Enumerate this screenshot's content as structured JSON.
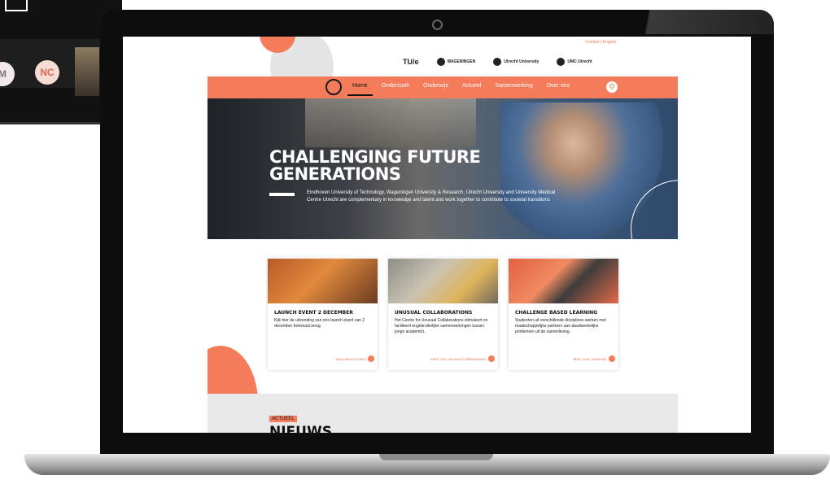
{
  "background_call": {
    "avatar_m": "M",
    "avatar_nc": "NC"
  },
  "site": {
    "top_links": "Contact | English",
    "logos": {
      "tue": "TU/e",
      "wageningen": "WAGENINGEN",
      "utrecht": "Utrecht University",
      "umc": "UMC Utrecht"
    },
    "nav": [
      "Home",
      "Onderzoek",
      "Onderwijs",
      "Actueel",
      "Samenwerking",
      "Over ons"
    ],
    "hero": {
      "title_line1": "CHALLENGING FUTURE",
      "title_line2": "GENERATIONS",
      "text": "Eindhoven University of Technology, Wageningen University & Research, Utrecht University and University Medical Centre Utrecht are complementary in knowledge and talent and work together to contribute to societal transitions"
    },
    "cards": [
      {
        "title": "LAUNCH EVENT 2 DECEMBER",
        "text": "Kijk hier de uitzending van ons launch event van 2 december helemaal terug.",
        "more": "Naar launch event"
      },
      {
        "title": "UNUSUAL COLLABORATIONS",
        "text": "Het Centre for Unusual Collaborations stimuleert en faciliteert ongebruikelijke samenwerkingen tussen jonge academici.",
        "more": "Meer over Unusual Collaborations"
      },
      {
        "title": "CHALLENGE BASED LEARNING",
        "text": "Studenten uit verschillende disciplines werken met maatschappelijke partners aan daadwerkelijke problemen uit de samenleving.",
        "more": "Meer over onderwijs"
      }
    ],
    "news_tag": "ACTUEEL",
    "news_heading": "NIEUWS"
  },
  "colors": {
    "accent": "#f47c5b"
  }
}
